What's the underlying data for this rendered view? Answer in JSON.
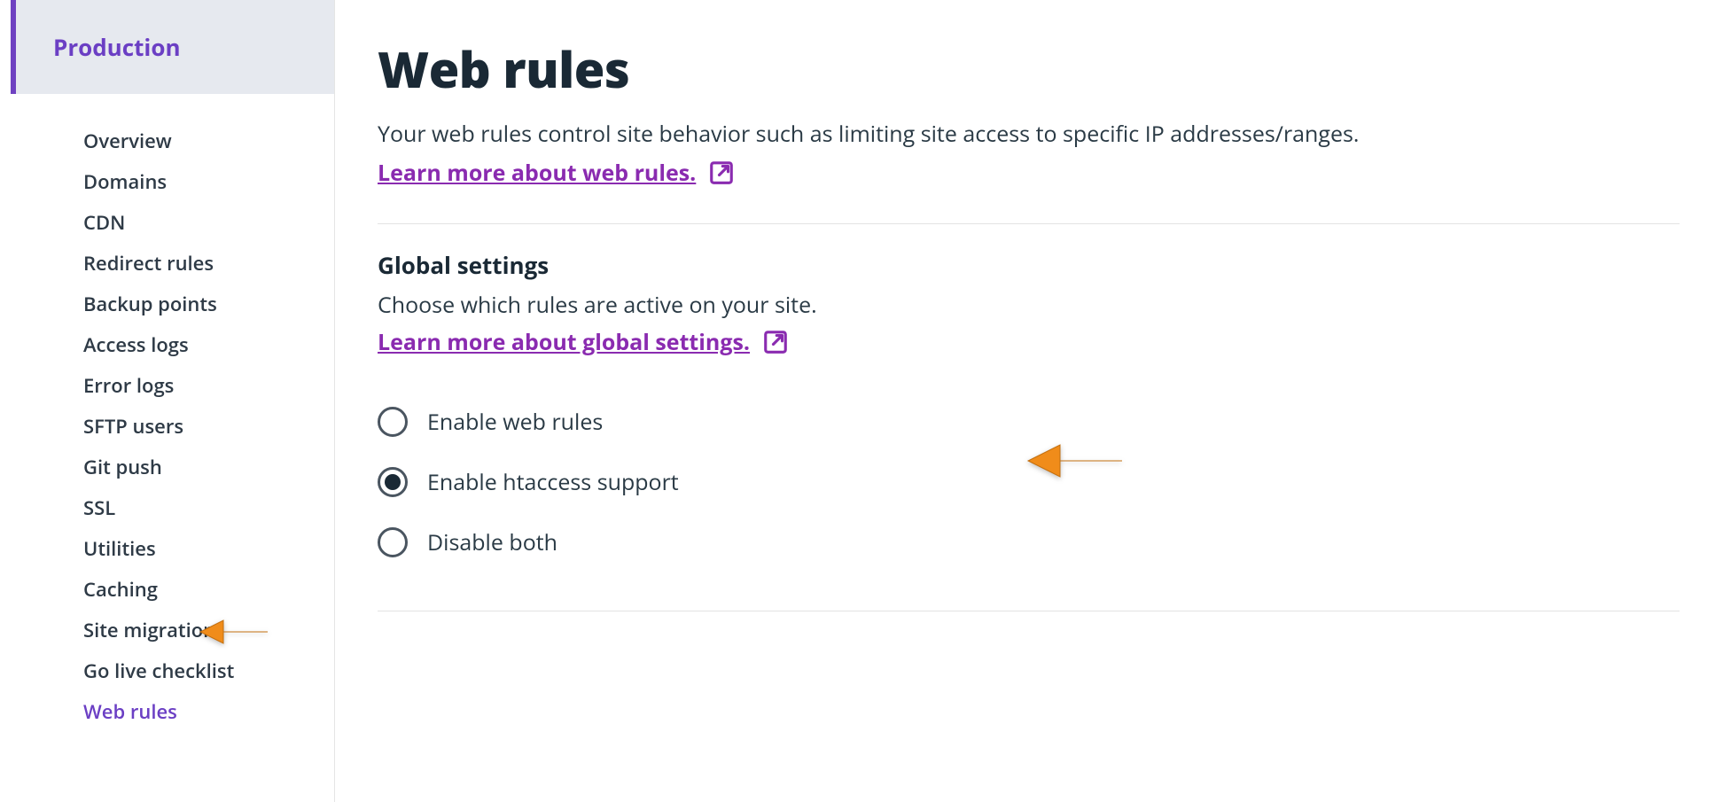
{
  "sidebar": {
    "header": "Production",
    "items": [
      {
        "label": "Overview",
        "active": false
      },
      {
        "label": "Domains",
        "active": false
      },
      {
        "label": "CDN",
        "active": false
      },
      {
        "label": "Redirect rules",
        "active": false
      },
      {
        "label": "Backup points",
        "active": false
      },
      {
        "label": "Access logs",
        "active": false
      },
      {
        "label": "Error logs",
        "active": false
      },
      {
        "label": "SFTP users",
        "active": false
      },
      {
        "label": "Git push",
        "active": false
      },
      {
        "label": "SSL",
        "active": false
      },
      {
        "label": "Utilities",
        "active": false
      },
      {
        "label": "Caching",
        "active": false
      },
      {
        "label": "Site migration",
        "active": false
      },
      {
        "label": "Go live checklist",
        "active": false
      },
      {
        "label": "Web rules",
        "active": true
      }
    ]
  },
  "main": {
    "title": "Web rules",
    "subtitle": "Your web rules control site behavior such as limiting site access to specific IP addresses/ranges.",
    "learnMoreTitle": "Learn more about web rules.",
    "globalSettings": {
      "heading": "Global settings",
      "sub": "Choose which rules are active on your site.",
      "learnMore": "Learn more about global settings.",
      "options": {
        "enableWebRules": "Enable web rules",
        "enableHtaccess": "Enable htaccess support",
        "disableBoth": "Disable both"
      },
      "selected": "enableHtaccess"
    }
  },
  "colors": {
    "purple": "#6f42c1",
    "linkPurple": "#8a2bb0",
    "arrow": "#f08c1a"
  }
}
